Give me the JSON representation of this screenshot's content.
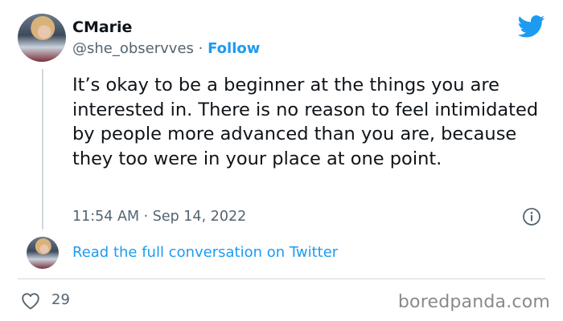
{
  "author": {
    "display_name": "CMarie",
    "handle": "@she_observves",
    "separator": " · ",
    "follow_label": "Follow"
  },
  "tweet": {
    "text": "It’s okay to be a beginner at the things you are interested in. There is no reason to feel intimidated by people more advanced than you are, because they too were in your place at one point.",
    "timestamp": "11:54 AM · Sep 14, 2022"
  },
  "conversation": {
    "link_label": "Read the full conversation on Twitter"
  },
  "engagement": {
    "likes": "29"
  },
  "watermark": "boredpanda.com",
  "icons": {
    "brand": "twitter-bird-icon",
    "info": "info-icon",
    "like": "heart-icon"
  },
  "colors": {
    "accent": "#1d9bf0",
    "text": "#0f1419",
    "secondary": "#536471",
    "divider": "#cfd9de"
  }
}
